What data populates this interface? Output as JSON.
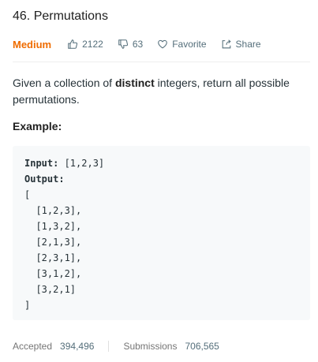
{
  "problem": {
    "title": "46. Permutations",
    "difficulty": "Medium",
    "likes": "2122",
    "dislikes": "63",
    "favorite_label": "Favorite",
    "share_label": "Share"
  },
  "colors": {
    "difficulty": "#ef6c00",
    "code_bg": "#f7f9fa",
    "divider": "#eeeeee"
  },
  "icons": [
    "thumbs-up-icon",
    "thumbs-down-icon",
    "heart-icon",
    "share-icon"
  ],
  "description": {
    "before": "Given a collection of ",
    "bold": "distinct",
    "after": " integers, return all possible permutations."
  },
  "example": {
    "heading": "Example:",
    "input_label": "Input:",
    "input_value": " [1,2,3]",
    "output_label": "Output:",
    "lines": [
      "[",
      "  [1,2,3],",
      "  [1,3,2],",
      "  [2,1,3],",
      "  [2,3,1],",
      "  [3,1,2],",
      "  [3,2,1]",
      "]"
    ]
  },
  "stats": {
    "accepted_label": "Accepted",
    "accepted_value": "394,496",
    "submissions_label": "Submissions",
    "submissions_value": "706,565"
  }
}
